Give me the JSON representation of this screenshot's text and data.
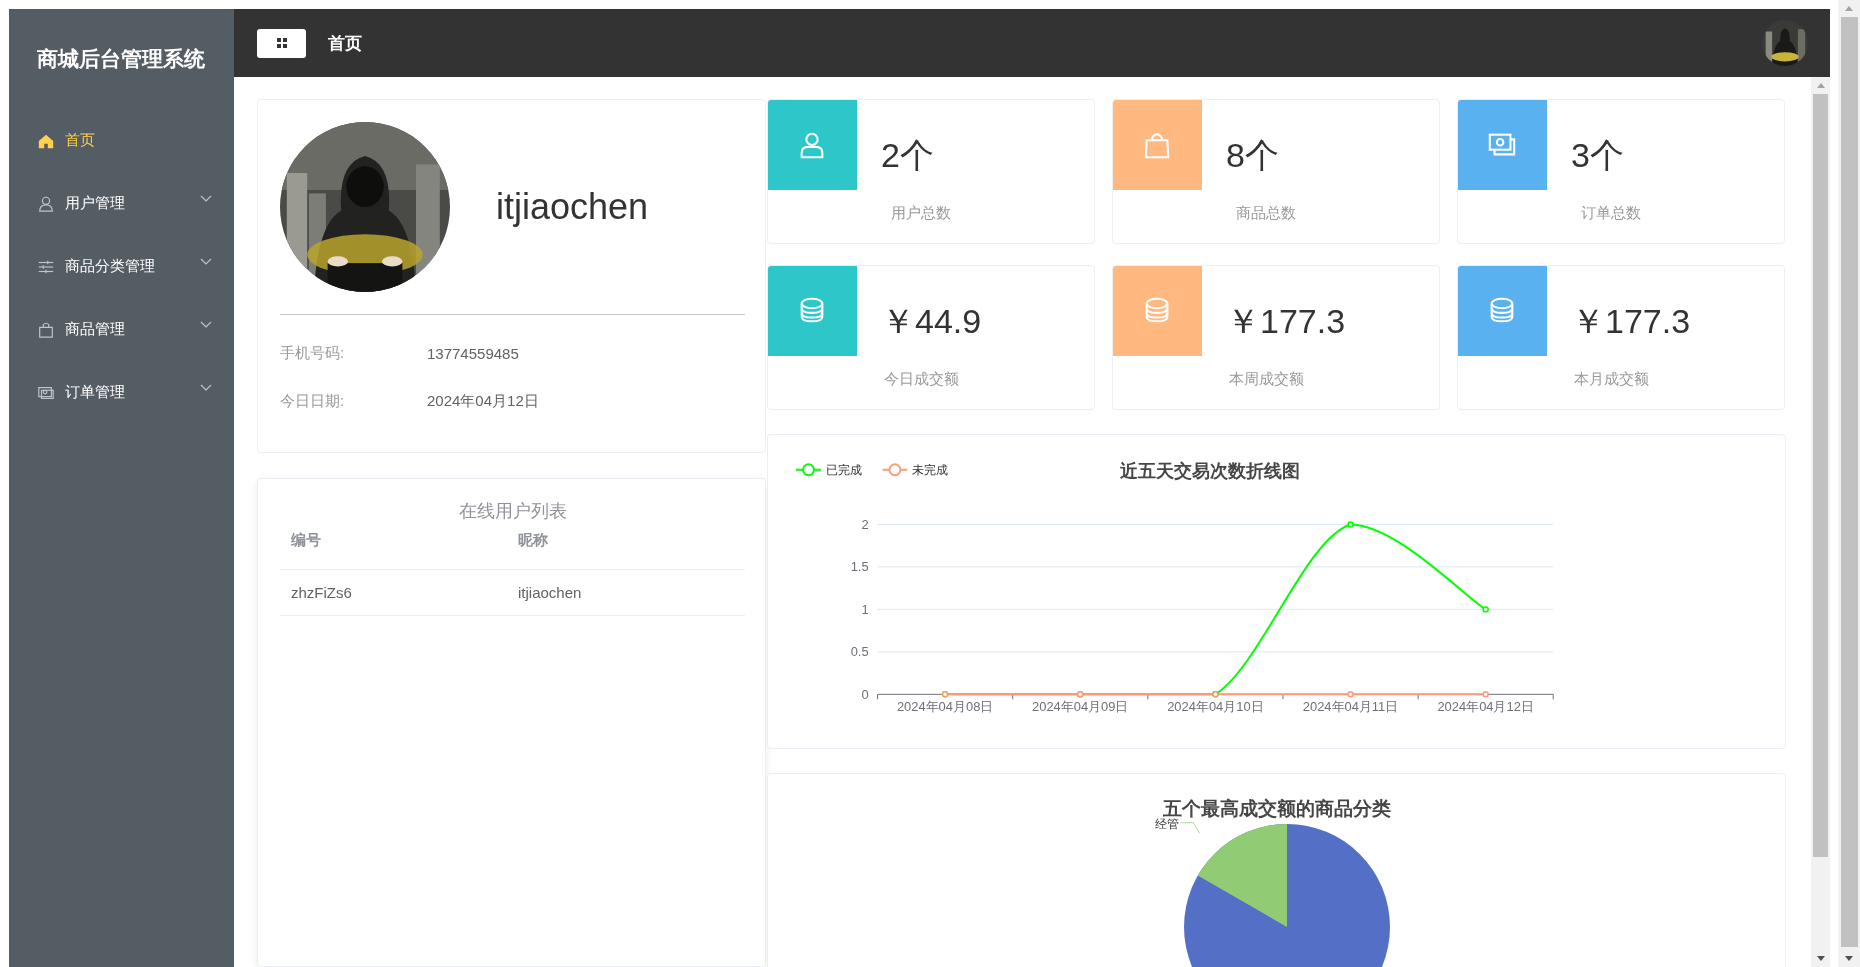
{
  "sidebar": {
    "title": "商城后台管理系统",
    "items": [
      {
        "label": "首页",
        "selected": true,
        "expandable": false
      },
      {
        "label": "用户管理",
        "selected": false,
        "expandable": true
      },
      {
        "label": "商品分类管理",
        "selected": false,
        "expandable": true
      },
      {
        "label": "商品管理",
        "selected": false,
        "expandable": true
      },
      {
        "label": "订单管理",
        "selected": false,
        "expandable": true
      }
    ]
  },
  "header": {
    "breadcrumb": "首页"
  },
  "profile": {
    "name": "itjiaochen",
    "fields": [
      {
        "label": "手机号码:",
        "value": "13774559485"
      },
      {
        "label": "今日日期:",
        "value": "2024年04月12日"
      }
    ]
  },
  "online_users": {
    "title": "在线用户列表",
    "columns": [
      "编号",
      "昵称"
    ],
    "rows": [
      [
        "zhzFiZs6",
        "itjiaochen"
      ]
    ]
  },
  "stats": [
    {
      "value": "2个",
      "label": "用户总数",
      "color": "#2ec7c9"
    },
    {
      "value": "8个",
      "label": "商品总数",
      "color": "#ffb980"
    },
    {
      "value": "3个",
      "label": "订单总数",
      "color": "#5ab1ef"
    },
    {
      "value": "￥44.9",
      "label": "今日成交额",
      "color": "#2ec7c9"
    },
    {
      "value": "￥177.3",
      "label": "本周成交额",
      "color": "#ffb980"
    },
    {
      "value": "￥177.3",
      "label": "本月成交额",
      "color": "#5ab1ef"
    }
  ],
  "line_chart": {
    "chart_data": {
      "type": "line",
      "title": "近五天交易次数折线图",
      "categories": [
        "2024年04月08日",
        "2024年04月09日",
        "2024年04月10日",
        "2024年04月11日",
        "2024年04月12日"
      ],
      "series": [
        {
          "name": "已完成",
          "color": "#00ff00",
          "marker": "circle",
          "values": [
            0,
            0,
            0,
            2,
            1
          ]
        },
        {
          "name": "未完成",
          "color": "#fc9a7a",
          "marker": "circle",
          "values": [
            0,
            0,
            0,
            0,
            0
          ]
        }
      ],
      "ylim": [
        0,
        2
      ],
      "yticks": [
        0,
        0.5,
        1,
        1.5,
        2
      ],
      "grid": true,
      "legend": true
    }
  },
  "pie_chart": {
    "title": "五个最高成交额的商品分类",
    "label": "经管"
  }
}
